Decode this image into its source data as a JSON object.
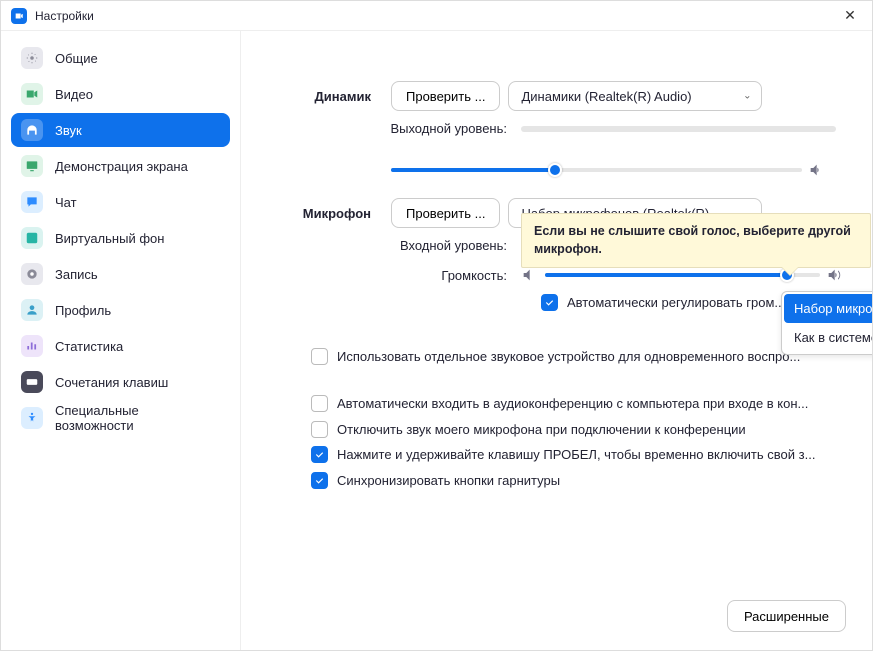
{
  "window": {
    "title": "Настройки"
  },
  "sidebar": {
    "items": [
      {
        "label": "Общие"
      },
      {
        "label": "Видео"
      },
      {
        "label": "Звук"
      },
      {
        "label": "Демонстрация экрана"
      },
      {
        "label": "Чат"
      },
      {
        "label": "Виртуальный фон"
      },
      {
        "label": "Запись"
      },
      {
        "label": "Профиль"
      },
      {
        "label": "Статистика"
      },
      {
        "label": "Сочетания клавиш"
      },
      {
        "label": "Специальные возможности"
      }
    ]
  },
  "speaker": {
    "label": "Динамик",
    "test_label": "Проверить ...",
    "selected": "Динамики (Realtek(R) Audio)",
    "output_level_label": "Выходной уровень:"
  },
  "mic": {
    "label": "Микрофон",
    "test_label": "Проверить ...",
    "selected": "Набор микрофонов (Realtek(R) ...",
    "input_level_label": "Входной уровень:",
    "volume_label": "Громкость:",
    "auto_adjust_label": "Автоматически регулировать гром...",
    "auto_adjust_checked": true,
    "dropdown": {
      "opt1": "Набор микрофонов (Realtek(R) Audio)",
      "opt2": "Как в системе"
    }
  },
  "tooltip": {
    "text": "Если вы не слышите свой голос, выберите другой микрофон."
  },
  "options": {
    "o1": {
      "label": "Использовать отдельное звуковое устройство для одновременного воспро...",
      "checked": false
    },
    "o2": {
      "label": "Автоматически входить в аудиоконференцию с компьютера при входе в кон...",
      "checked": false
    },
    "o3": {
      "label": "Отключить звук моего микрофона при подключении к конференции",
      "checked": false
    },
    "o4": {
      "label": "Нажмите и удерживайте клавишу ПРОБЕЛ, чтобы временно включить свой з...",
      "checked": true
    },
    "o5": {
      "label": "Синхронизировать кнопки гарнитуры",
      "checked": true
    }
  },
  "advanced_label": "Расширенные",
  "volume_percent": 88
}
